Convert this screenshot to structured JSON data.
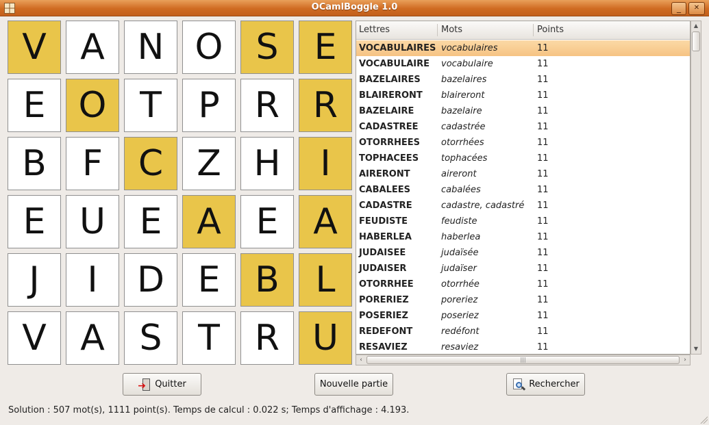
{
  "window": {
    "title": "OCamlBoggle 1.0",
    "minimize_glyph": "_",
    "maximize_glyph": "□",
    "close_glyph": "✕"
  },
  "board": {
    "highlight_color": "#e9c54a",
    "cells": [
      {
        "letter": "V",
        "hl": true
      },
      {
        "letter": "A",
        "hl": false
      },
      {
        "letter": "N",
        "hl": false
      },
      {
        "letter": "O",
        "hl": false
      },
      {
        "letter": "S",
        "hl": true
      },
      {
        "letter": "E",
        "hl": true
      },
      {
        "letter": "E",
        "hl": false
      },
      {
        "letter": "O",
        "hl": true
      },
      {
        "letter": "T",
        "hl": false
      },
      {
        "letter": "P",
        "hl": false
      },
      {
        "letter": "R",
        "hl": false
      },
      {
        "letter": "R",
        "hl": true
      },
      {
        "letter": "B",
        "hl": false
      },
      {
        "letter": "F",
        "hl": false
      },
      {
        "letter": "C",
        "hl": true
      },
      {
        "letter": "Z",
        "hl": false
      },
      {
        "letter": "H",
        "hl": false
      },
      {
        "letter": "I",
        "hl": true
      },
      {
        "letter": "E",
        "hl": false
      },
      {
        "letter": "U",
        "hl": false
      },
      {
        "letter": "E",
        "hl": false
      },
      {
        "letter": "A",
        "hl": true
      },
      {
        "letter": "E",
        "hl": false
      },
      {
        "letter": "A",
        "hl": true
      },
      {
        "letter": "J",
        "hl": false
      },
      {
        "letter": "I",
        "hl": false
      },
      {
        "letter": "D",
        "hl": false
      },
      {
        "letter": "E",
        "hl": false
      },
      {
        "letter": "B",
        "hl": true
      },
      {
        "letter": "L",
        "hl": true
      },
      {
        "letter": "V",
        "hl": false
      },
      {
        "letter": "A",
        "hl": false
      },
      {
        "letter": "S",
        "hl": false
      },
      {
        "letter": "T",
        "hl": false
      },
      {
        "letter": "R",
        "hl": false
      },
      {
        "letter": "U",
        "hl": true
      }
    ]
  },
  "results": {
    "columns": [
      "Lettres",
      "Mots",
      "Points"
    ],
    "rows": [
      {
        "lettres": "VOCABULAIRES",
        "mots": "vocabulaires",
        "points": "11",
        "selected": true
      },
      {
        "lettres": "VOCABULAIRE",
        "mots": "vocabulaire",
        "points": "11",
        "selected": false
      },
      {
        "lettres": "BAZELAIRES",
        "mots": "bazelaires",
        "points": "11",
        "selected": false
      },
      {
        "lettres": "BLAIRERONT",
        "mots": "blaireront",
        "points": "11",
        "selected": false
      },
      {
        "lettres": "BAZELAIRE",
        "mots": "bazelaire",
        "points": "11",
        "selected": false
      },
      {
        "lettres": "CADASTREE",
        "mots": "cadastrée",
        "points": "11",
        "selected": false
      },
      {
        "lettres": "OTORRHEES",
        "mots": "otorrhées",
        "points": "11",
        "selected": false
      },
      {
        "lettres": "TOPHACEES",
        "mots": "tophacées",
        "points": "11",
        "selected": false
      },
      {
        "lettres": "AIRERONT",
        "mots": "aireront",
        "points": "11",
        "selected": false
      },
      {
        "lettres": "CABALEES",
        "mots": "cabalées",
        "points": "11",
        "selected": false
      },
      {
        "lettres": "CADASTRE",
        "mots": "cadastre, cadastré",
        "points": "11",
        "selected": false
      },
      {
        "lettres": "FEUDISTE",
        "mots": "feudiste",
        "points": "11",
        "selected": false
      },
      {
        "lettres": "HABERLEA",
        "mots": "haberlea",
        "points": "11",
        "selected": false
      },
      {
        "lettres": "JUDAISEE",
        "mots": "judaïsée",
        "points": "11",
        "selected": false
      },
      {
        "lettres": "JUDAISER",
        "mots": "judaïser",
        "points": "11",
        "selected": false
      },
      {
        "lettres": "OTORRHEE",
        "mots": "otorrhée",
        "points": "11",
        "selected": false
      },
      {
        "lettres": "PORERIEZ",
        "mots": "poreriez",
        "points": "11",
        "selected": false
      },
      {
        "lettres": "POSERIEZ",
        "mots": "poseriez",
        "points": "11",
        "selected": false
      },
      {
        "lettres": "REDEFONT",
        "mots": "redéfont",
        "points": "11",
        "selected": false
      },
      {
        "lettres": "RESAVIEZ",
        "mots": "resaviez",
        "points": "11",
        "selected": false
      }
    ]
  },
  "buttons": {
    "quit_label": "Quitter",
    "new_game_label": "Nouvelle partie",
    "search_label": "Rechercher"
  },
  "status": {
    "text": "Solution : 507 mot(s), 1111 point(s). Temps de calcul : 0.022 s; Temps d'affichage : 4.193."
  },
  "icons": {
    "app": "boggle-grid-icon",
    "quit": "exit-door-icon",
    "search": "magnifier-document-icon"
  }
}
